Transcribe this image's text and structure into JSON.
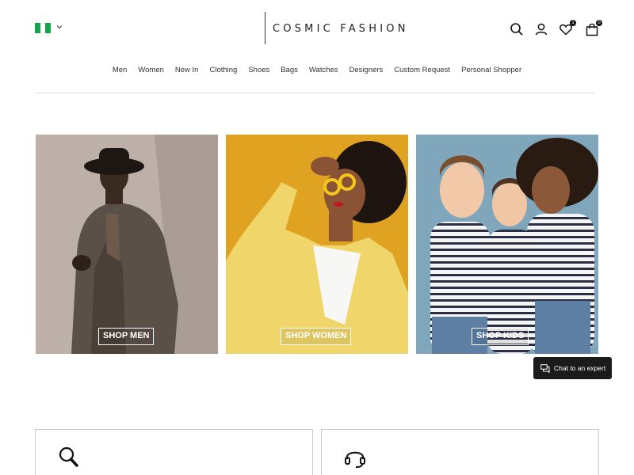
{
  "header": {
    "brand": "COSMIC FASHION",
    "country_flag_icon": "nigeria-flag-icon",
    "icons": [
      "search-icon",
      "user-icon",
      "heart-icon",
      "shopping-bag-icon"
    ],
    "wishlist_count": "1",
    "bag_count": "0"
  },
  "nav": {
    "items": [
      "Men",
      "Women",
      "New In",
      "Clothing",
      "Shoes",
      "Bags",
      "Watches",
      "Designers",
      "Custom Request",
      "Personal Shopper"
    ]
  },
  "tiles": {
    "men": "SHOP MEN",
    "women": "SHOP WOMEN",
    "kids": "SHOP KIDS"
  },
  "chat": {
    "label": "Chat to an expert",
    "icon": "chat-bubbles-icon"
  },
  "features": {
    "left_icon": "magnifier-icon",
    "right_icon": "headset-icon"
  },
  "colors": {
    "text": "#222222",
    "chat_bg": "#1b1b1b",
    "flag_green": "#16a34a",
    "women_bg": "#e2a51f"
  }
}
